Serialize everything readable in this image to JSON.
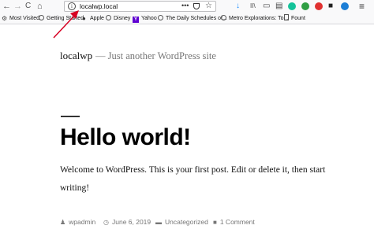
{
  "browser": {
    "back_glyph": "←",
    "forward_glyph": "→",
    "reload_glyph": "C",
    "home_glyph": "⌂",
    "info_glyph": "i",
    "url": "localwp.local",
    "page_actions_glyph": "•••",
    "star_glyph": "☆",
    "accent_color": "#0a84ff",
    "annotation_color": "#d70022"
  },
  "toolbar_icons": {
    "download_glyph": "↓",
    "library_glyph": "II\\",
    "sidebar_glyph": "▭",
    "reader_glyph": "▤",
    "grammarly_glyph": "G",
    "ext_green_glyph": "G",
    "ext_red_glyph": "S",
    "ext_dark_glyph": "■",
    "ext_blue_glyph": "S",
    "menu_glyph": "≡"
  },
  "bookmarks": [
    {
      "label": "Most Visited",
      "icon": "gear-icon"
    },
    {
      "label": "Getting Started",
      "icon": "globe-icon"
    },
    {
      "label": "Apple",
      "icon": "apple-icon"
    },
    {
      "label": "Disney",
      "icon": "globe-icon"
    },
    {
      "label": "Yahoo",
      "icon": "yahoo-icon"
    },
    {
      "label": "The Daily Schedules of...",
      "icon": "globe-icon"
    },
    {
      "label": "Metro Explorations: To...",
      "icon": "globe-icon"
    },
    {
      "label": "Fount",
      "icon": "document-icon"
    }
  ],
  "site": {
    "title": "localwp",
    "separator": "—",
    "tagline": "Just another WordPress site"
  },
  "post": {
    "title": "Hello world!",
    "body_line1": "Welcome to WordPress. This is your first post. Edit or delete it, then start",
    "body_line2": "writing!",
    "author": "wpadmin",
    "date": "June 6, 2019",
    "category": "Uncategorized",
    "comments": "1 Comment",
    "author_icon": "♟",
    "date_icon": "◷",
    "category_icon": "▬",
    "comments_icon": "■"
  }
}
